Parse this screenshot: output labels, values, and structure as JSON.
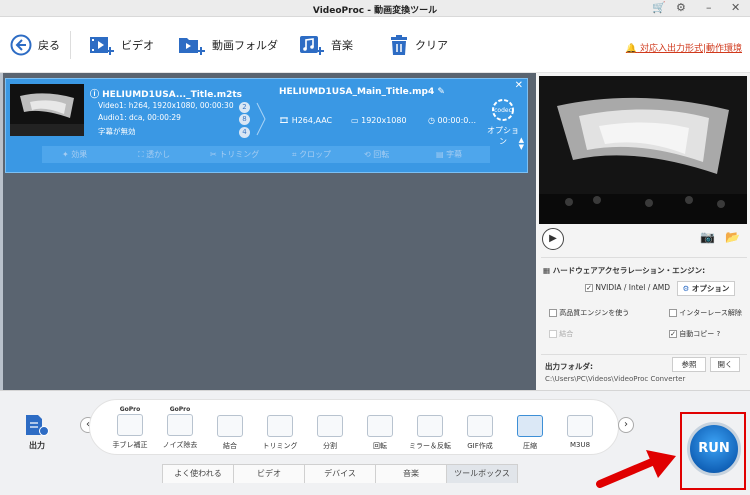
{
  "window": {
    "title": "VideoProc - 動画変換ツール"
  },
  "toolbar": {
    "back": "戻る",
    "video": "ビデオ",
    "folder": "動画フォルダ",
    "music": "音楽",
    "clear": "クリア",
    "notice": "対応入出力形式|動作環境"
  },
  "file": {
    "source_name": "HELIUMD1USA..._Title.m2ts",
    "video_info": "Video1: h264, 1920x1080, 00:00:30",
    "audio_info": "Audio1: dca, 00:00:29",
    "subtitle_info": "字幕が無効",
    "video_count": "2",
    "audio_count": "8",
    "subtitle_count": "4",
    "output_name": "HELIUMD1USA_Main_Title.mp4",
    "output_codec": "H264,AAC",
    "output_resolution": "1920x1080",
    "output_duration": "00:00:0...",
    "codec_badge": "codec",
    "option_label": "オプション",
    "tools": [
      "効果",
      "透かし",
      "トリミング",
      "クロップ",
      "回転",
      "字幕"
    ]
  },
  "settings": {
    "hw_title": "ハードウェアアクセラレーション・エンジン:",
    "gpu_label": "NVIDIA / Intel / AMD",
    "option_button": "オプション",
    "high_quality": "高品質エンジンを使う",
    "deinterlace": "インターレース解除",
    "merge": "結合",
    "autocopy": "自動コピー",
    "help": "?",
    "output_folder_label": "出力フォルダ:",
    "browse": "参照",
    "open": "開く",
    "output_path": "C:\\Users\\PC\\Videos\\VideoProc Converter"
  },
  "bottom": {
    "output_label": "出力",
    "tools": [
      {
        "label": "手ブレ補正",
        "brand": "GoPro"
      },
      {
        "label": "ノイズ除去",
        "brand": "GoPro"
      },
      {
        "label": "結合",
        "brand": ""
      },
      {
        "label": "トリミング",
        "brand": ""
      },
      {
        "label": "分割",
        "brand": ""
      },
      {
        "label": "回転",
        "brand": ""
      },
      {
        "label": "ミラー＆反転",
        "brand": ""
      },
      {
        "label": "GIF作成",
        "brand": ""
      },
      {
        "label": "圧縮",
        "brand": ""
      },
      {
        "label": "M3U8",
        "brand": ""
      }
    ],
    "tabs": [
      "よく使われる",
      "ビデオ",
      "デバイス",
      "音楽",
      "ツールボックス"
    ],
    "run_label": "RUN"
  },
  "colors": {
    "accent": "#3a98e4",
    "run_highlight": "#e00000",
    "notice": "#d0391c"
  }
}
